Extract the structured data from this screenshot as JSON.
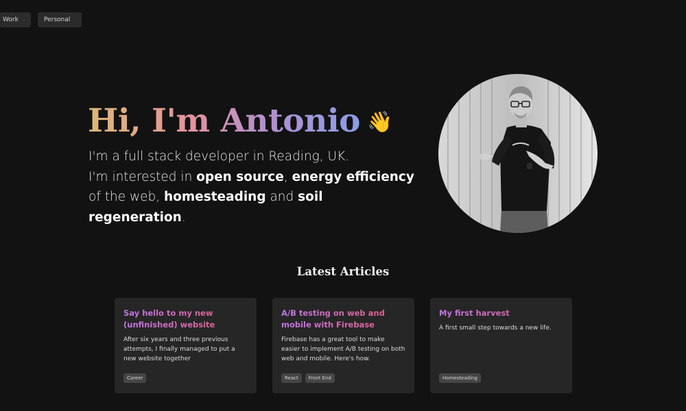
{
  "nav": {
    "items": [
      {
        "label": "Work",
        "icon": "chevron-down-icon"
      },
      {
        "label": "Personal",
        "icon": "chevron-down-icon"
      }
    ]
  },
  "hero": {
    "title": "Hi, I'm Antonio",
    "emoji": "👋",
    "line1": "I'm a full stack developer in Reading, UK.",
    "line2_prefix": "I'm interested in ",
    "kw1": "open source",
    "sep1": ", ",
    "kw2": "energy efficiency",
    "line2_mid": " of the web, ",
    "kw3": "homesteading",
    "sep2": " and ",
    "kw4": "soil regeneration",
    "end": "."
  },
  "articles": {
    "heading": "Latest Articles",
    "items": [
      {
        "title": "Say hello to my new (unfinished) website",
        "description": "After six years and three previous attempts, I finally managed to put a new website together",
        "tags": [
          "Career"
        ]
      },
      {
        "title": "A/B testing on web and mobile with Firebase",
        "description": "Firebase has a great tool to make easier to implement A/B testing on both web and mobile. Here's how.",
        "tags": [
          "React",
          "Front End"
        ]
      },
      {
        "title": "My first harvest",
        "description": "A first small step towards a new life.",
        "tags": [
          "Homesteading"
        ]
      }
    ]
  },
  "colors": {
    "background": "#121212",
    "card": "#262626",
    "title_gradient": [
      "#dcb877",
      "#e4939d",
      "#b28fce",
      "#8a9ee6"
    ],
    "card_title_gradient": [
      "#c275e8",
      "#e5607d"
    ]
  }
}
